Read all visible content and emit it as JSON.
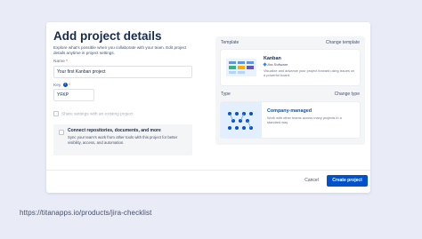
{
  "modal": {
    "title": "Add project details",
    "description": "Explore what's possible when you collaborate with your team. Edit project details anytime in project settings.",
    "name_label": "Name",
    "name_value": "Your first Kanban project",
    "key_label": "Key",
    "key_value": "YFKP",
    "share_label": "Share settings with an existing project",
    "connect": {
      "title": "Connect repositories, documents, and more",
      "description": "Sync your team's work from other tools with this project for better visibility, access, and automation."
    },
    "template": {
      "header": "Template",
      "change_link": "Change template",
      "name": "Kanban",
      "product": "Jira Software",
      "description": "Visualize and advance your project forward using issues on a powerful board."
    },
    "type": {
      "header": "Type",
      "change_link": "Change type",
      "name": "Company-managed",
      "description": "Work with other teams across many projects in a standard way."
    },
    "cancel_label": "Cancel",
    "create_label": "Create project"
  },
  "footer_url": "https://titanapps.io/products/jira-checklist",
  "colors": {
    "primary": "#0052cc",
    "background": "#e9ebf7",
    "panel": "#f4f5f7",
    "required": "#de350b"
  }
}
